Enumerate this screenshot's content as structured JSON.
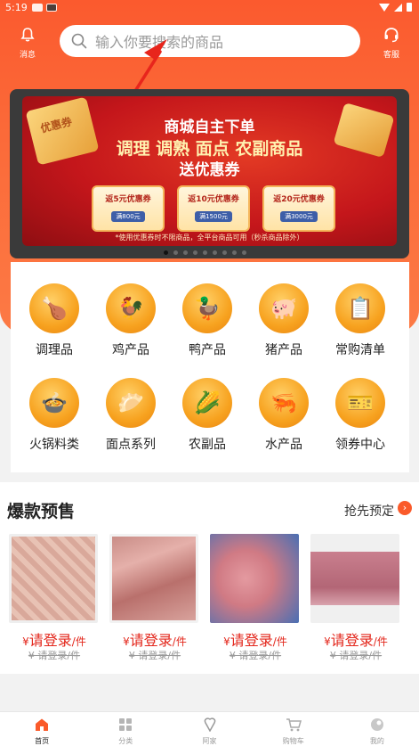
{
  "status_bar": {
    "time": "5:19"
  },
  "header": {
    "message_label": "消息",
    "service_label": "客服",
    "search_placeholder": "输入你要搜索的商品"
  },
  "banner": {
    "ticket_text": "优惠券",
    "line1": "商城自主下单",
    "line2": "调理 调熟 面点 农副商品",
    "line3": "送优惠券",
    "coupons": [
      {
        "title": "返5元优惠券",
        "cond": "满800元"
      },
      {
        "title": "返10元优惠券",
        "cond": "满1500元"
      },
      {
        "title": "返20元优惠券",
        "cond": "满3000元"
      }
    ],
    "note": "*使用优惠券时不限商品，全平台商品可用（秒杀商品除外）",
    "dots_count": 9,
    "active_dot": 0
  },
  "categories": [
    {
      "label": "调理品",
      "icon": "nuggets-icon"
    },
    {
      "label": "鸡产品",
      "icon": "chicken-icon"
    },
    {
      "label": "鸭产品",
      "icon": "duck-icon"
    },
    {
      "label": "猪产品",
      "icon": "pig-icon"
    },
    {
      "label": "常购清单",
      "icon": "clipboard-icon"
    },
    {
      "label": "火锅料类",
      "icon": "hotpot-icon"
    },
    {
      "label": "面点系列",
      "icon": "dumpling-icon"
    },
    {
      "label": "农副品",
      "icon": "corn-icon"
    },
    {
      "label": "水产品",
      "icon": "shrimp-icon"
    },
    {
      "label": "领券中心",
      "icon": "coupon-icon"
    }
  ],
  "presale": {
    "title": "爆款预售",
    "more_label": "抢先预定",
    "products": [
      {
        "currency": "¥",
        "price": "请登录",
        "unit": "/件",
        "orig": "¥ 请登录/件"
      },
      {
        "currency": "¥",
        "price": "请登录",
        "unit": "/件",
        "orig": "¥ 请登录/件"
      },
      {
        "currency": "¥",
        "price": "请登录",
        "unit": "/件",
        "orig": "¥ 请登录/件"
      },
      {
        "currency": "¥",
        "price": "请登录",
        "unit": "/件",
        "orig": "¥ 请登录/件"
      }
    ]
  },
  "tabbar": [
    {
      "label": "首页",
      "icon": "home-icon",
      "active": true
    },
    {
      "label": "分类",
      "icon": "category-icon",
      "active": false
    },
    {
      "label": "阿家",
      "icon": "brand-icon",
      "active": false
    },
    {
      "label": "购物车",
      "icon": "cart-icon",
      "active": false
    },
    {
      "label": "我的",
      "icon": "profile-icon",
      "active": false
    }
  ],
  "colors": {
    "brand": "#fb5a2e",
    "price": "#e3261b",
    "active_tab": "#fa5a2a"
  }
}
